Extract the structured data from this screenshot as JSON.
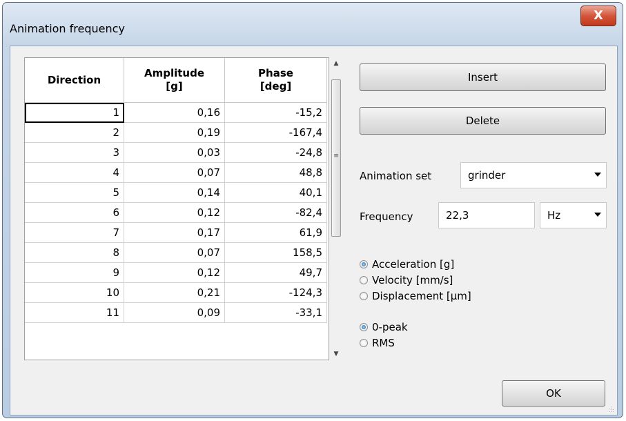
{
  "window": {
    "title": "Animation frequency",
    "close_glyph": "X"
  },
  "table": {
    "headers": [
      {
        "line1": "Direction",
        "line2": ""
      },
      {
        "line1": "Amplitude",
        "line2": "[g]"
      },
      {
        "line1": "Phase",
        "line2": "[deg]"
      }
    ],
    "rows": [
      [
        "1",
        "0,16",
        "-15,2"
      ],
      [
        "2",
        "0,19",
        "-167,4"
      ],
      [
        "3",
        "0,03",
        "-24,8"
      ],
      [
        "4",
        "0,07",
        "48,8"
      ],
      [
        "5",
        "0,14",
        "40,1"
      ],
      [
        "6",
        "0,12",
        "-82,4"
      ],
      [
        "7",
        "0,17",
        "61,9"
      ],
      [
        "8",
        "0,07",
        "158,5"
      ],
      [
        "9",
        "0,12",
        "49,7"
      ],
      [
        "10",
        "0,21",
        "-124,3"
      ],
      [
        "11",
        "0,09",
        "-33,1"
      ]
    ]
  },
  "buttons": {
    "insert": "Insert",
    "delete": "Delete",
    "ok": "OK"
  },
  "animation_set": {
    "label": "Animation set",
    "value": "grinder"
  },
  "frequency": {
    "label": "Frequency",
    "value": "22,3",
    "unit": "Hz"
  },
  "quantity_options": [
    {
      "label": "Acceleration [g]",
      "checked": true
    },
    {
      "label": "Velocity [mm/s]",
      "checked": false
    },
    {
      "label": "Displacement [µm]",
      "checked": false
    }
  ],
  "scale_options": [
    {
      "label": "0-peak",
      "checked": true
    },
    {
      "label": "RMS",
      "checked": false
    }
  ],
  "icons": {
    "close": "close-icon",
    "scroll_up": "scroll-up-arrow-icon",
    "scroll_down": "scroll-down-arrow-icon",
    "dropdown": "chevron-down-icon"
  },
  "colors": {
    "selection_radio": "#1d5fa8",
    "close_button": "#c0391d"
  }
}
